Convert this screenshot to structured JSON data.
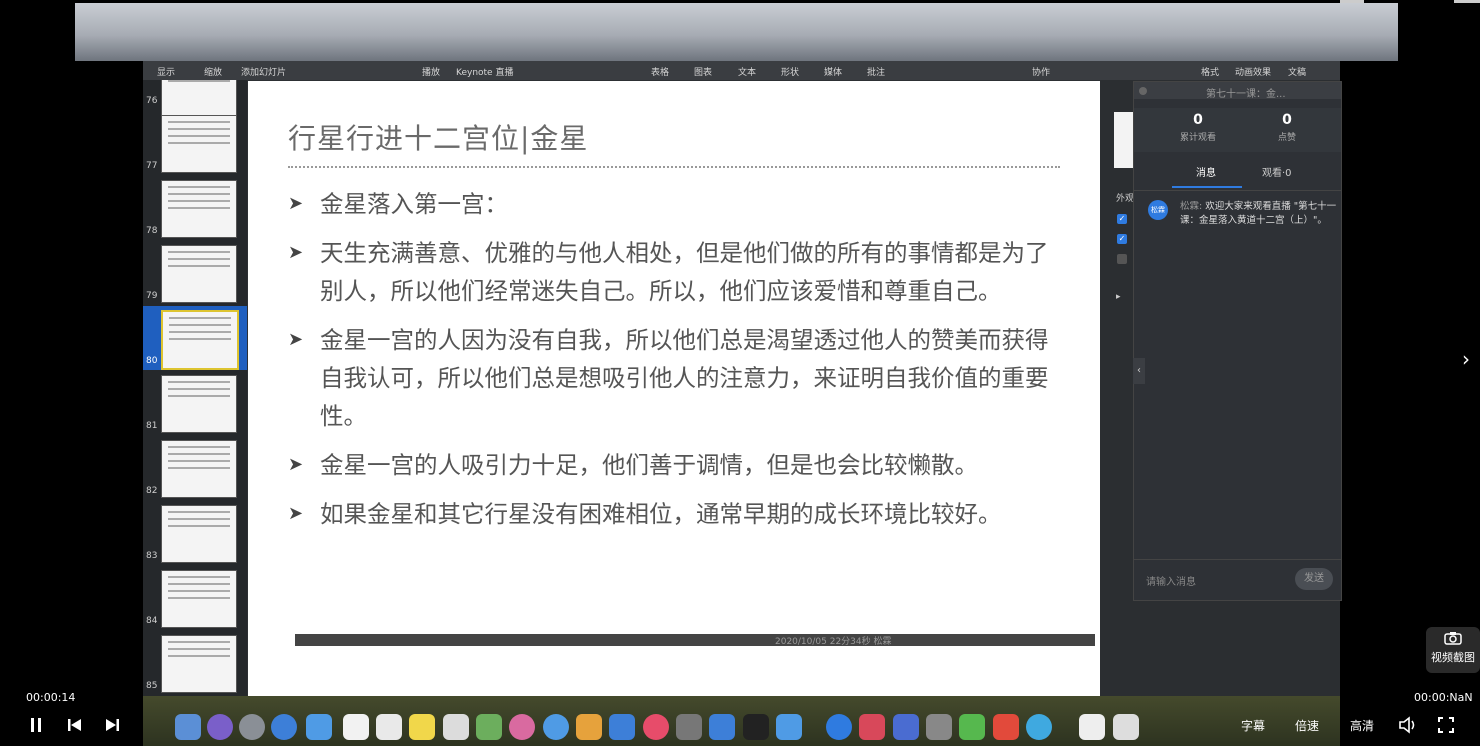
{
  "keynote": {
    "toolbar": [
      "显示",
      "缩放",
      "添加幻灯片",
      "播放",
      "Keynote 直播",
      "表格",
      "图表",
      "文本",
      "形状",
      "媒体",
      "批注",
      "协作",
      "格式",
      "动画效果",
      "文稿"
    ],
    "slide_numbers": [
      "76",
      "77",
      "78",
      "79",
      "80",
      "81",
      "82",
      "83",
      "84",
      "85"
    ],
    "selected_slide": "80"
  },
  "slide": {
    "title": "行星行进十二宫位|金星",
    "bullets": [
      "金星落入第一宫：",
      "天生充满善意、优雅的与他人相处，但是他们做的所有的事情都是为了别人，所以他们经常迷失自己。所以，他们应该爱惜和尊重自己。",
      "金星一宫的人因为没有自我，所以他们总是渴望透过他人的赞美而获得自我认可，所以他们总是想吸引他人的注意力，来证明自我价值的重要性。",
      "金星一宫的人吸引力十足，他们善于调情，但是也会比较懒散。",
      "如果金星和其它行星没有困难相位，通常早期的成长环境比较好。"
    ]
  },
  "format_panel": {
    "label": "外观"
  },
  "live": {
    "title": "第七十一课：金...",
    "stats": [
      {
        "value": "0",
        "label": "累计观看"
      },
      {
        "value": "0",
        "label": "点赞"
      }
    ],
    "tabs": [
      "消息",
      "观看·0"
    ],
    "message": {
      "avatar": "松霖",
      "user": "松霖:",
      "text": "欢迎大家来观看直播 \"第七十一课：金星落入黄道十二宫（上）\"。"
    },
    "input_placeholder": "请输入消息",
    "send_label": "发送"
  },
  "status_strip": "2020/10/05 22分34秒 松霖",
  "player": {
    "time_current": "00:00:14",
    "time_total": "00:00:NaN",
    "subtitle_label": "字幕",
    "speed_label": "倍速",
    "quality_label": "高清",
    "snapshot_label": "视频截图"
  }
}
